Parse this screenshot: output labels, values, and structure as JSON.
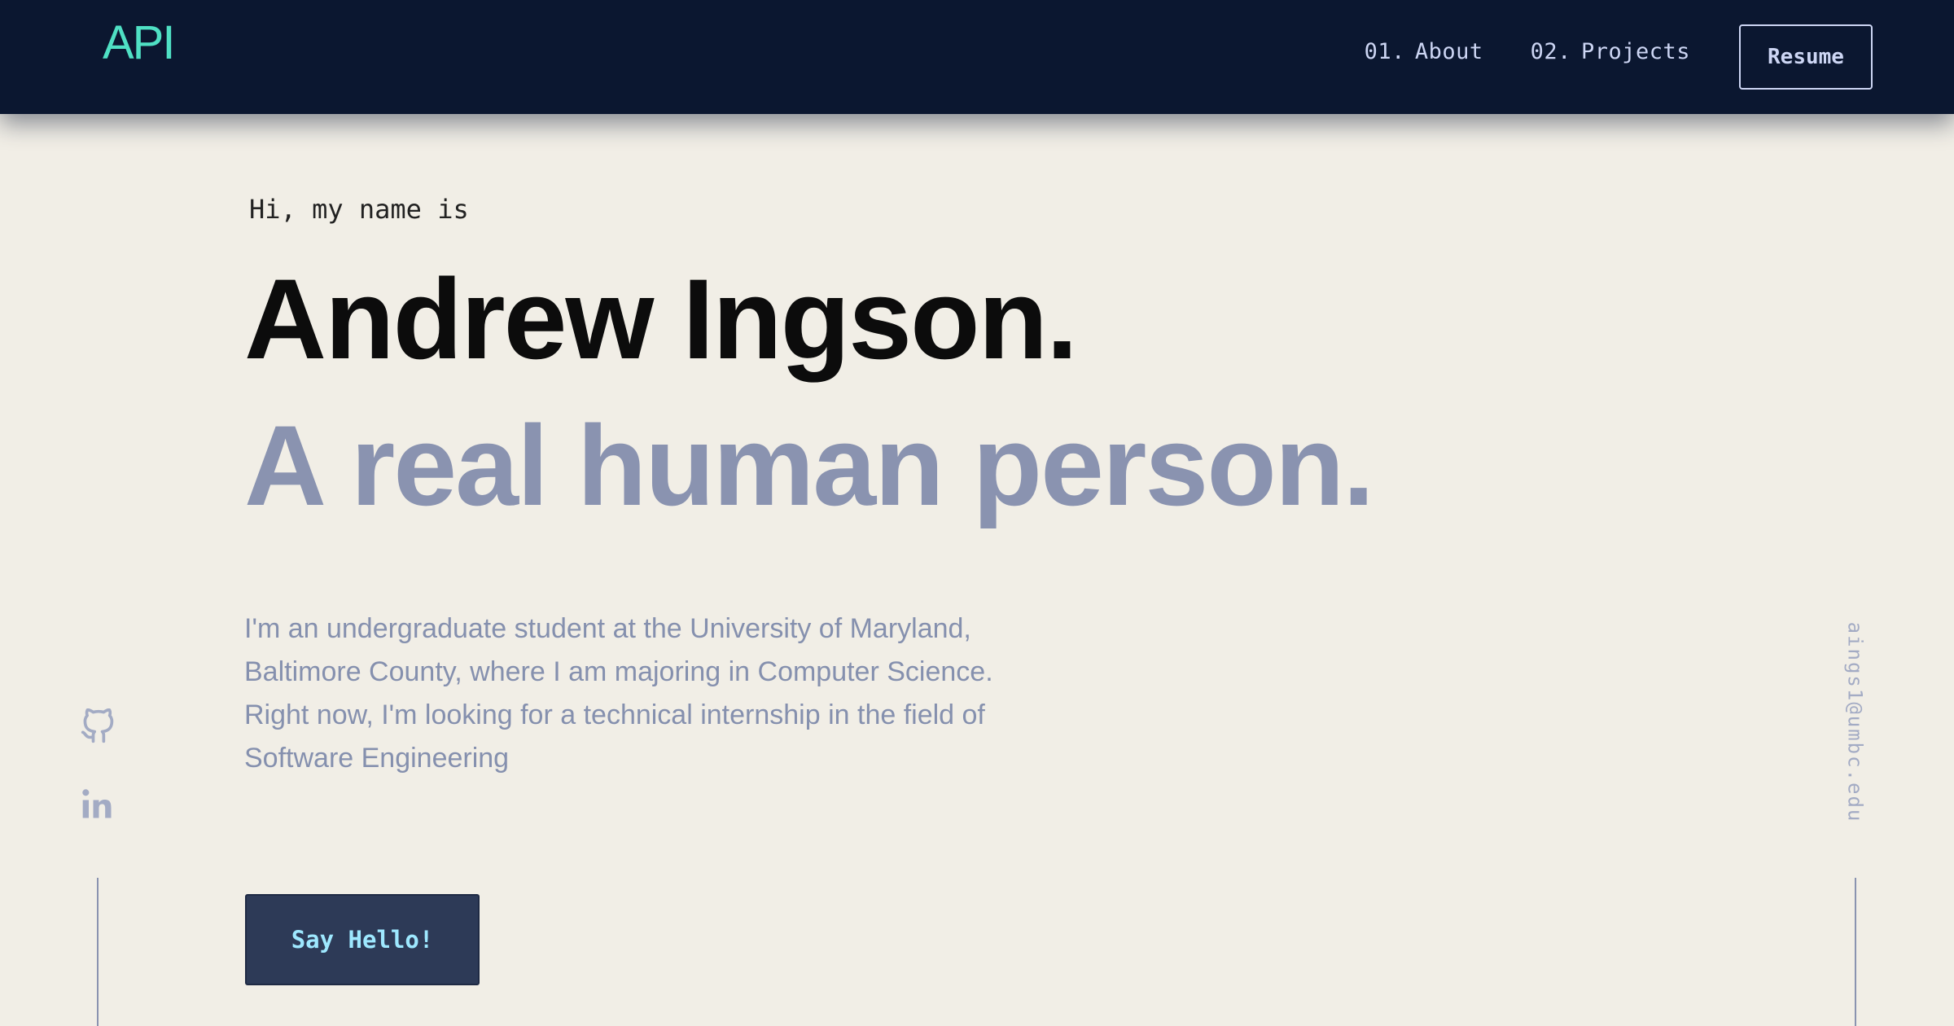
{
  "nav": {
    "logo": "API",
    "links": [
      {
        "num": "01.",
        "label": "About"
      },
      {
        "num": "02.",
        "label": "Projects"
      }
    ],
    "resume_label": "Resume"
  },
  "hero": {
    "greeting": "Hi, my name is",
    "name": "Andrew Ingson.",
    "tagline": "A real human person.",
    "bio": "I'm an undergraduate student at the University of Maryland, Baltimore County, where I am majoring in Computer Science. Right now, I'm looking for a technical internship in the field of Software Engineering",
    "cta_label": "Say Hello!"
  },
  "social": {
    "icons": [
      "github-icon",
      "linkedin-icon"
    ]
  },
  "email": "aings1@umbc.edu",
  "colors": {
    "nav_bg": "#0b1730",
    "page_bg": "#f1eee6",
    "accent": "#4fe0c4",
    "muted": "#8a93b0",
    "button_bg": "#2d3a57"
  }
}
